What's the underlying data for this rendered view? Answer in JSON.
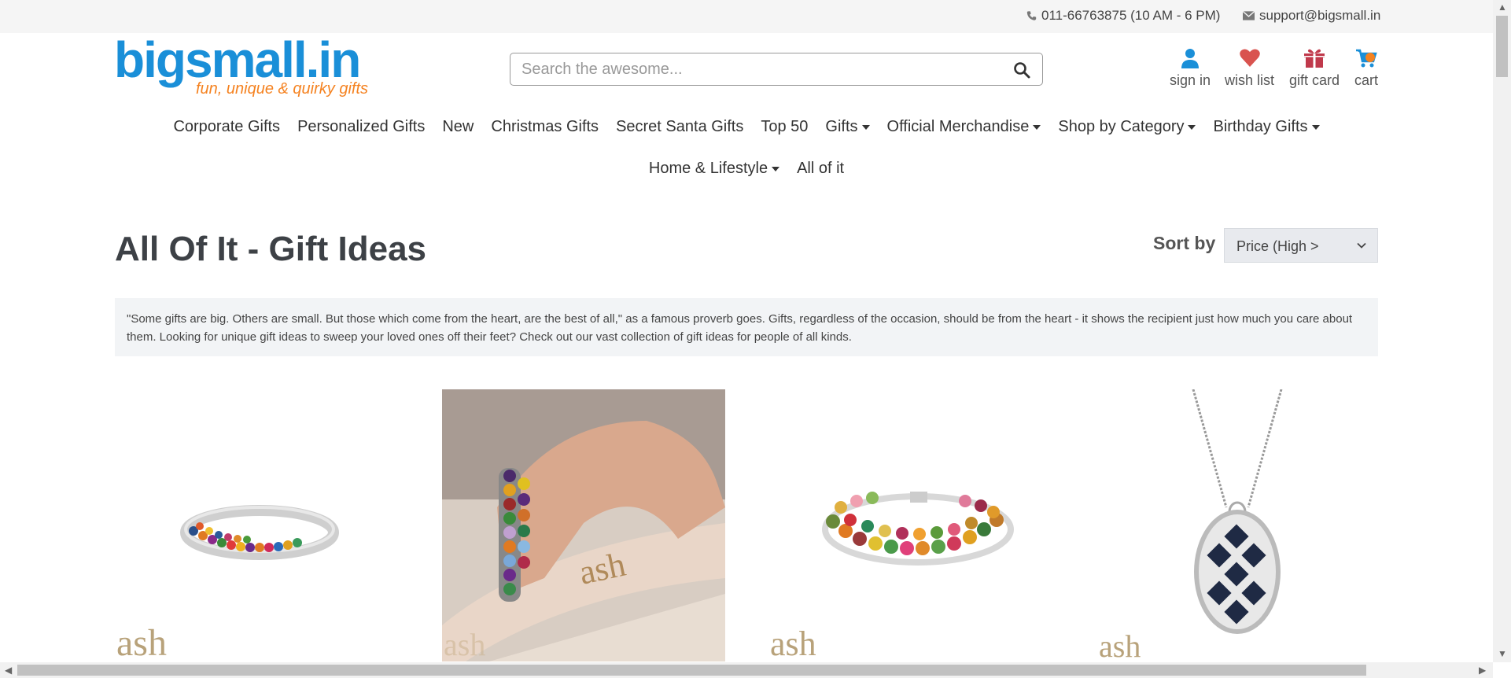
{
  "topbar": {
    "phone": "011-66763875 (10 AM - 6 PM)",
    "email": "support@bigsmall.in"
  },
  "logo": {
    "name": "bigsmall.in",
    "tagline": "fun, unique & quirky gifts"
  },
  "search": {
    "placeholder": "Search the awesome..."
  },
  "user_links": {
    "sign_in": "sign in",
    "wish_list": "wish list",
    "gift_card": "gift card",
    "cart": "cart"
  },
  "nav_row1": [
    {
      "label": "Corporate Gifts",
      "dropdown": false
    },
    {
      "label": "Personalized Gifts",
      "dropdown": false
    },
    {
      "label": "New",
      "dropdown": false
    },
    {
      "label": "Christmas Gifts",
      "dropdown": false
    },
    {
      "label": "Secret Santa Gifts",
      "dropdown": false
    },
    {
      "label": "Top 50",
      "dropdown": false
    },
    {
      "label": "Gifts",
      "dropdown": true
    },
    {
      "label": "Official Merchandise",
      "dropdown": true
    },
    {
      "label": "Shop by Category",
      "dropdown": true
    },
    {
      "label": "Birthday Gifts",
      "dropdown": true
    }
  ],
  "nav_row2": [
    {
      "label": "Home & Lifestyle",
      "dropdown": true
    },
    {
      "label": "All of it",
      "dropdown": false
    }
  ],
  "page": {
    "title": "All Of It - Gift Ideas",
    "sort_label": "Sort by",
    "sort_value": "Price (High >",
    "intro": "\"Some gifts are big. Others are small. But those which come from the heart, are the best of all,\" as a famous proverb goes. Gifts, regardless of the occasion, should be from the heart - it shows the recipient just how much you care about them. Looking for unique gift ideas to sweep your loved ones off their feet? Check out our vast collection of gift ideas for people of all kinds."
  },
  "products": [
    {
      "image": "multicolor-gemstone-bangle",
      "brand": "ash"
    },
    {
      "image": "gemstone-bracelet-on-wrist",
      "brand": "ash"
    },
    {
      "image": "tourmaline-bracelet",
      "brand": "ash"
    },
    {
      "image": "sapphire-lattice-pendant",
      "brand": "ash"
    }
  ],
  "colors": {
    "logo_blue": "#1a8fd8",
    "logo_orange": "#f58220",
    "user_icon_blue": "#1a8fd8",
    "heart_red": "#d9534f",
    "gift_red": "#c0394b"
  }
}
